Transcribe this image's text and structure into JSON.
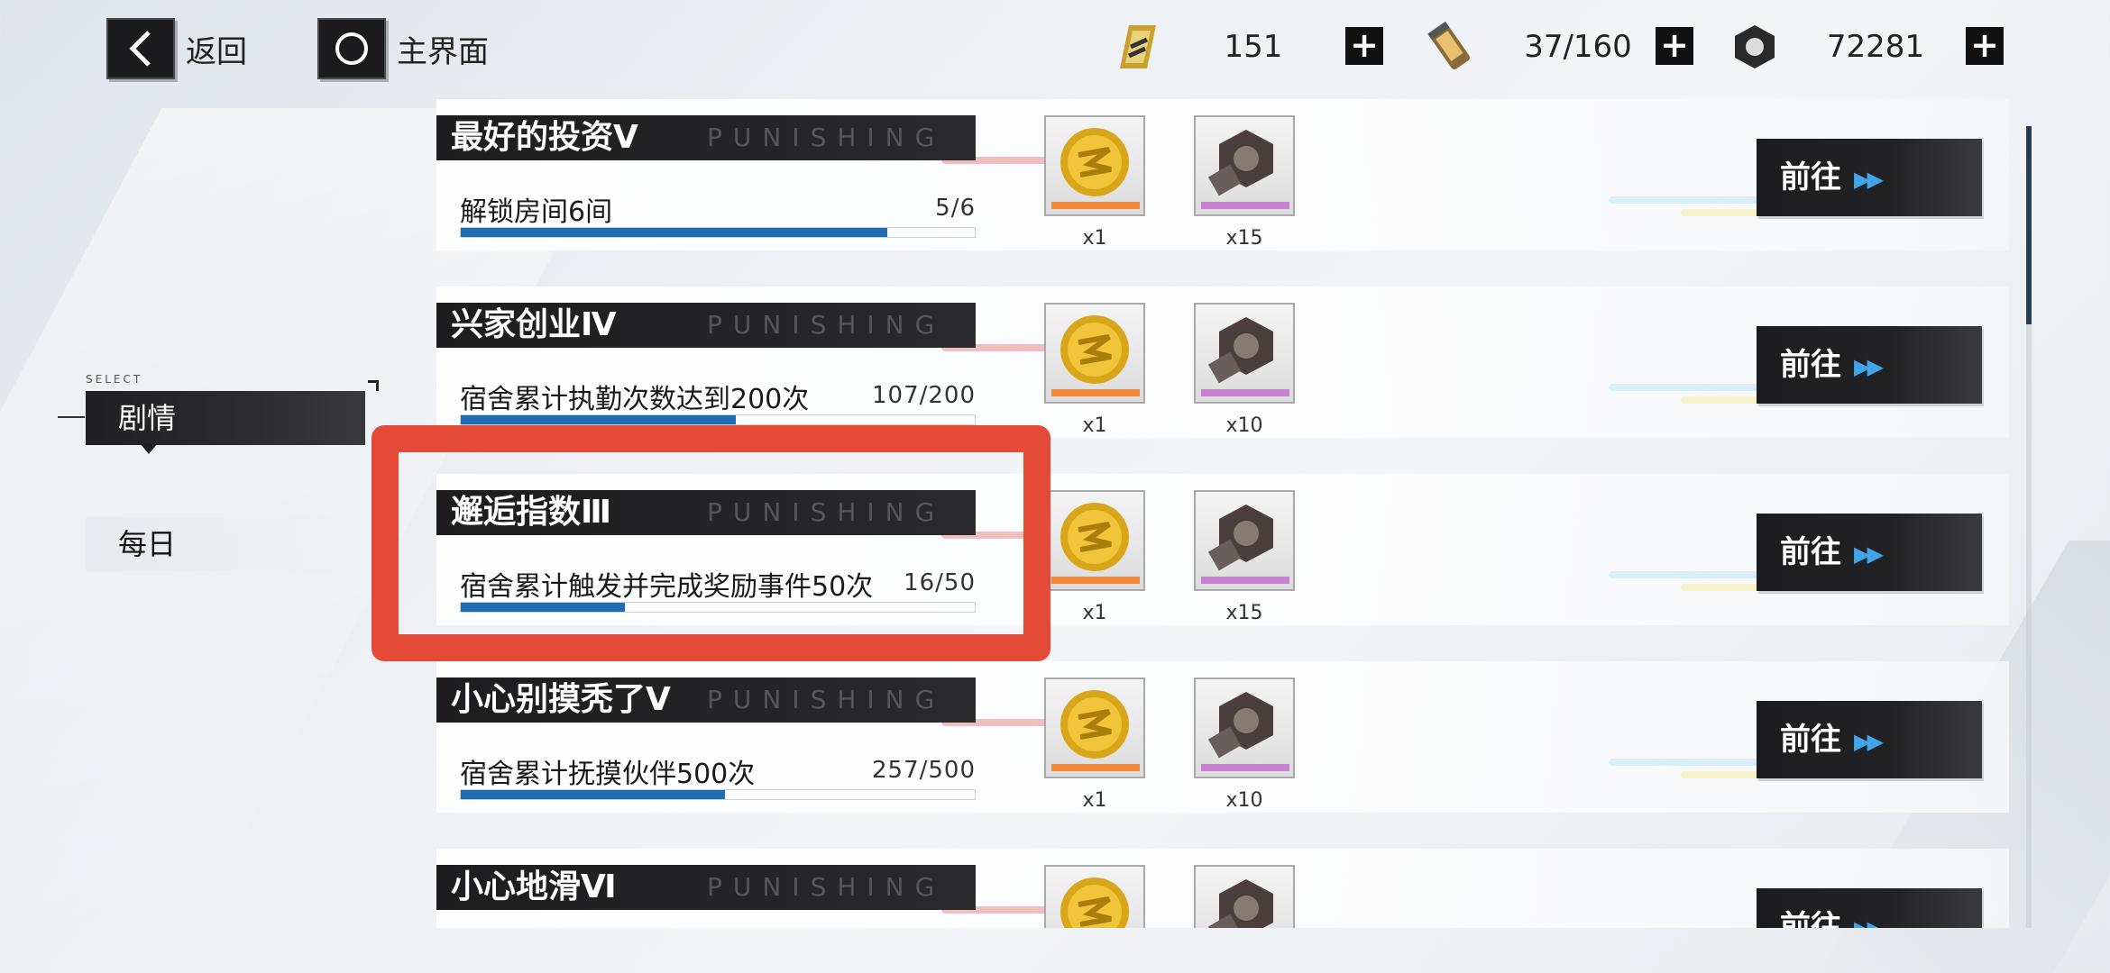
{
  "header": {
    "back_label": "返回",
    "home_label": "主界面",
    "resources": [
      {
        "icon": "battery-icon",
        "value": "151"
      },
      {
        "icon": "energy-cell-icon",
        "value": "37/160"
      },
      {
        "icon": "nut-currency-icon",
        "value": "72281"
      }
    ]
  },
  "sidebar": {
    "select_caption": "SELECT",
    "items": [
      {
        "label": "剧情",
        "active": true
      },
      {
        "label": "每日",
        "active": false
      }
    ]
  },
  "tasks": [
    {
      "title": "最好的投资Ⅴ",
      "watermark": "PUNISHING",
      "description": "解锁房间6间",
      "progress_text": "5/6",
      "progress": 0.83,
      "rewards": [
        {
          "icon": "gold-coin-icon",
          "qty": "x1"
        },
        {
          "icon": "bolt-nut-icon",
          "qty": "x15"
        }
      ],
      "go_label": "前往"
    },
    {
      "title": "兴家创业Ⅳ",
      "watermark": "PUNISHING",
      "description": "宿舍累计执勤次数达到200次",
      "progress_text": "107/200",
      "progress": 0.535,
      "rewards": [
        {
          "icon": "gold-coin-icon",
          "qty": "x1"
        },
        {
          "icon": "bolt-nut-icon",
          "qty": "x10"
        }
      ],
      "go_label": "前往"
    },
    {
      "title": "邂逅指数Ⅲ",
      "watermark": "PUNISHING",
      "description": "宿舍累计触发并完成奖励事件50次",
      "progress_text": "16/50",
      "progress": 0.32,
      "rewards": [
        {
          "icon": "gold-coin-icon",
          "qty": "x1"
        },
        {
          "icon": "bolt-nut-icon",
          "qty": "x15"
        }
      ],
      "go_label": "前往"
    },
    {
      "title": "小心别摸秃了Ⅴ",
      "watermark": "PUNISHING",
      "description": "宿舍累计抚摸伙伴500次",
      "progress_text": "257/500",
      "progress": 0.514,
      "rewards": [
        {
          "icon": "gold-coin-icon",
          "qty": "x1"
        },
        {
          "icon": "bolt-nut-icon",
          "qty": "x10"
        }
      ],
      "go_label": "前往"
    },
    {
      "title": "小心地滑Ⅵ",
      "watermark": "PUNISHING",
      "description": "",
      "progress_text": "",
      "progress": 0,
      "rewards": [
        {
          "icon": "gold-coin-icon",
          "qty": ""
        },
        {
          "icon": "bolt-nut-icon",
          "qty": ""
        }
      ],
      "go_label": "前往"
    }
  ],
  "colors": {
    "accent": "#1f6db4",
    "highlight": "#e54a36",
    "arrow": "#3fa5e8"
  }
}
